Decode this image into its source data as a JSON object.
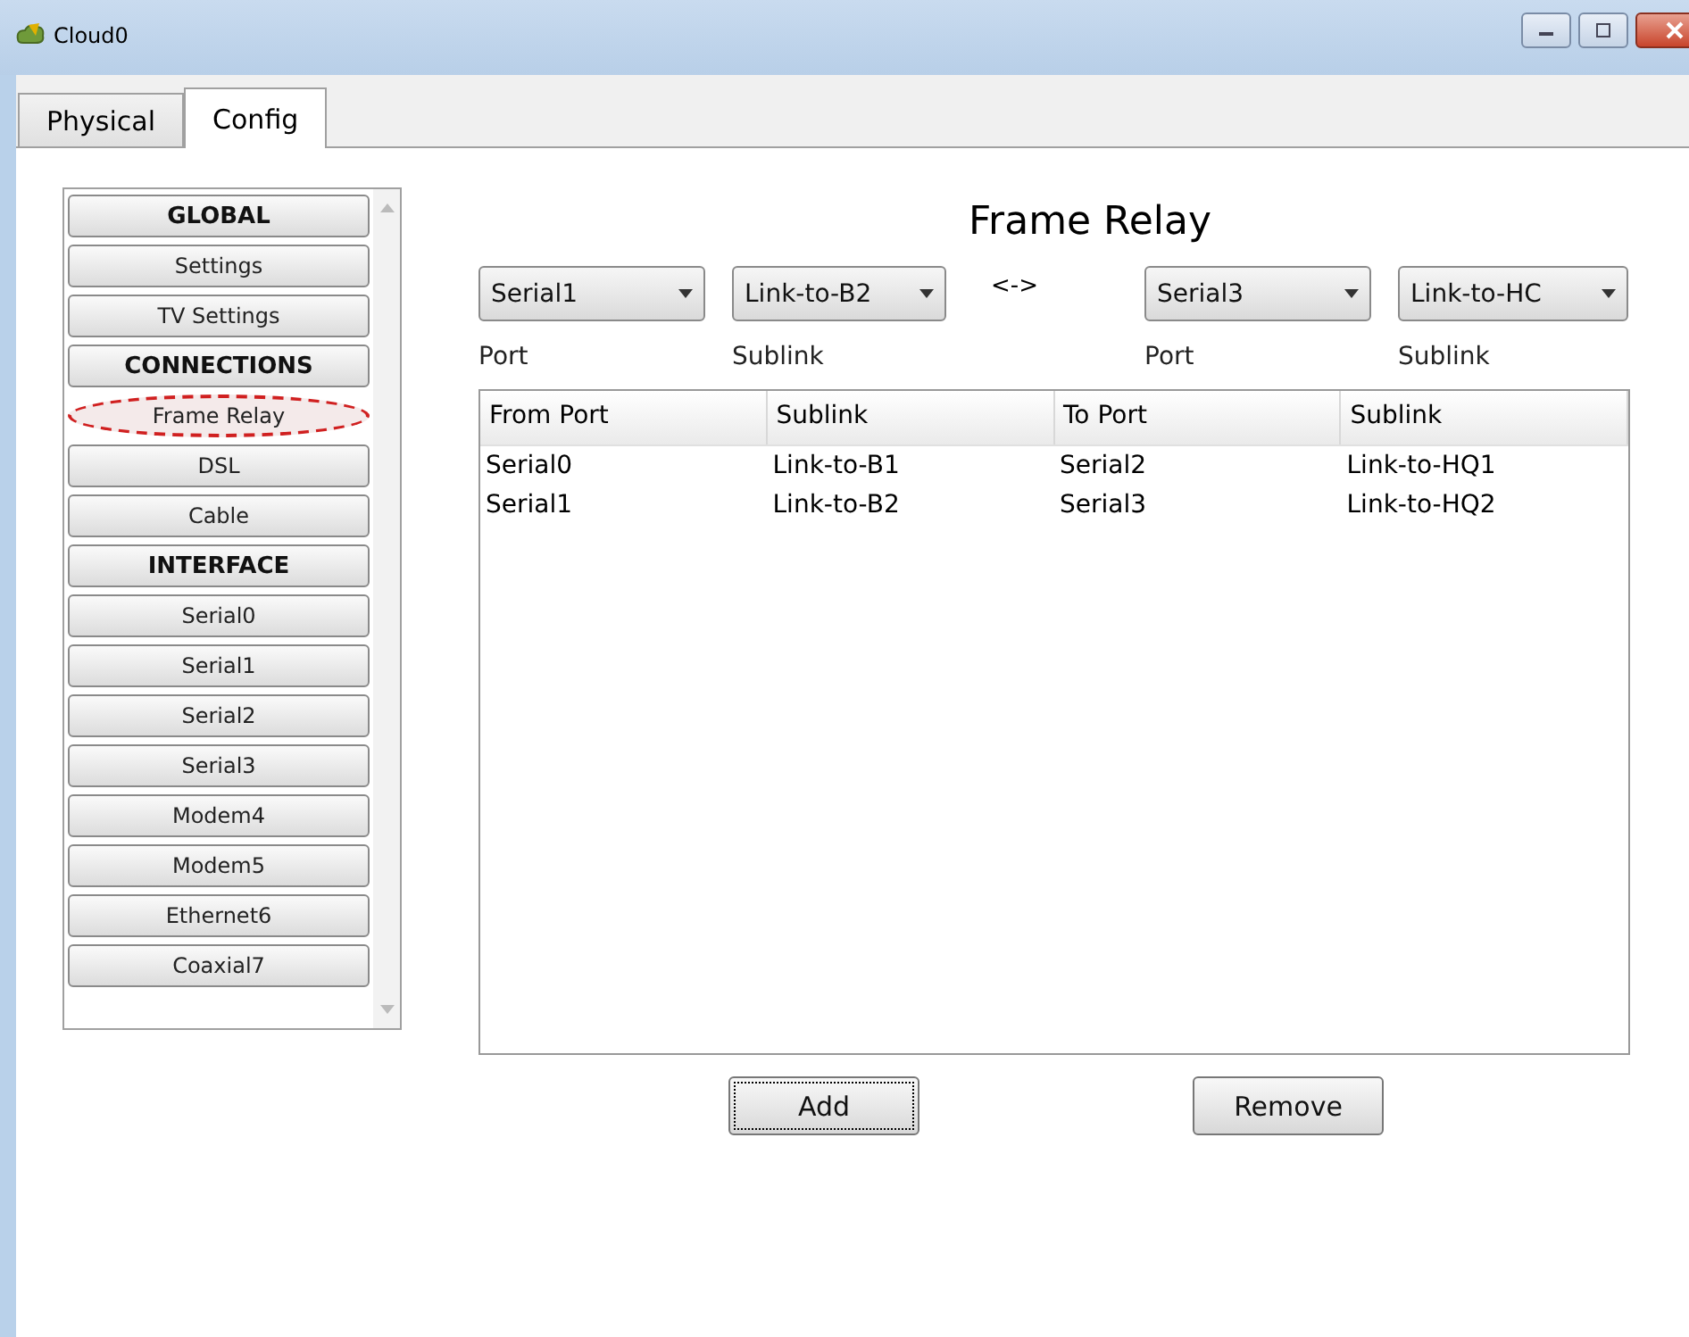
{
  "window": {
    "title": "Cloud0"
  },
  "tabs": [
    {
      "label": "Physical",
      "selected": false
    },
    {
      "label": "Config",
      "selected": true
    }
  ],
  "sidebar": {
    "items": [
      {
        "kind": "header",
        "label": "GLOBAL",
        "circled": false
      },
      {
        "kind": "button",
        "label": "Settings",
        "circled": false
      },
      {
        "kind": "button",
        "label": "TV Settings",
        "circled": false
      },
      {
        "kind": "header",
        "label": "CONNECTIONS",
        "circled": false
      },
      {
        "kind": "button",
        "label": "Frame Relay",
        "circled": true
      },
      {
        "kind": "button",
        "label": "DSL",
        "circled": false
      },
      {
        "kind": "button",
        "label": "Cable",
        "circled": false
      },
      {
        "kind": "header",
        "label": "INTERFACE",
        "circled": false
      },
      {
        "kind": "button",
        "label": "Serial0",
        "circled": false
      },
      {
        "kind": "button",
        "label": "Serial1",
        "circled": false
      },
      {
        "kind": "button",
        "label": "Serial2",
        "circled": false
      },
      {
        "kind": "button",
        "label": "Serial3",
        "circled": false
      },
      {
        "kind": "button",
        "label": "Modem4",
        "circled": false
      },
      {
        "kind": "button",
        "label": "Modem5",
        "circled": false
      },
      {
        "kind": "button",
        "label": "Ethernet6",
        "circled": false
      },
      {
        "kind": "button",
        "label": "Coaxial7",
        "circled": false
      }
    ]
  },
  "panel": {
    "title": "Frame Relay",
    "from_port": {
      "value": "Serial1",
      "label": "Port"
    },
    "from_sublink": {
      "value": "Link-to-B2",
      "label": "Sublink"
    },
    "separator": "<->",
    "to_port": {
      "value": "Serial3",
      "label": "Port"
    },
    "to_sublink": {
      "value": "Link-to-HC",
      "label": "Sublink"
    },
    "table": {
      "columns": [
        "From Port",
        "Sublink",
        "To Port",
        "Sublink"
      ],
      "rows": [
        [
          "Serial0",
          "Link-to-B1",
          "Serial2",
          "Link-to-HQ1"
        ],
        [
          "Serial1",
          "Link-to-B2",
          "Serial3",
          "Link-to-HQ2"
        ]
      ]
    },
    "buttons": [
      {
        "label": "Add",
        "focused": true
      },
      {
        "label": "Remove",
        "focused": false
      }
    ]
  }
}
